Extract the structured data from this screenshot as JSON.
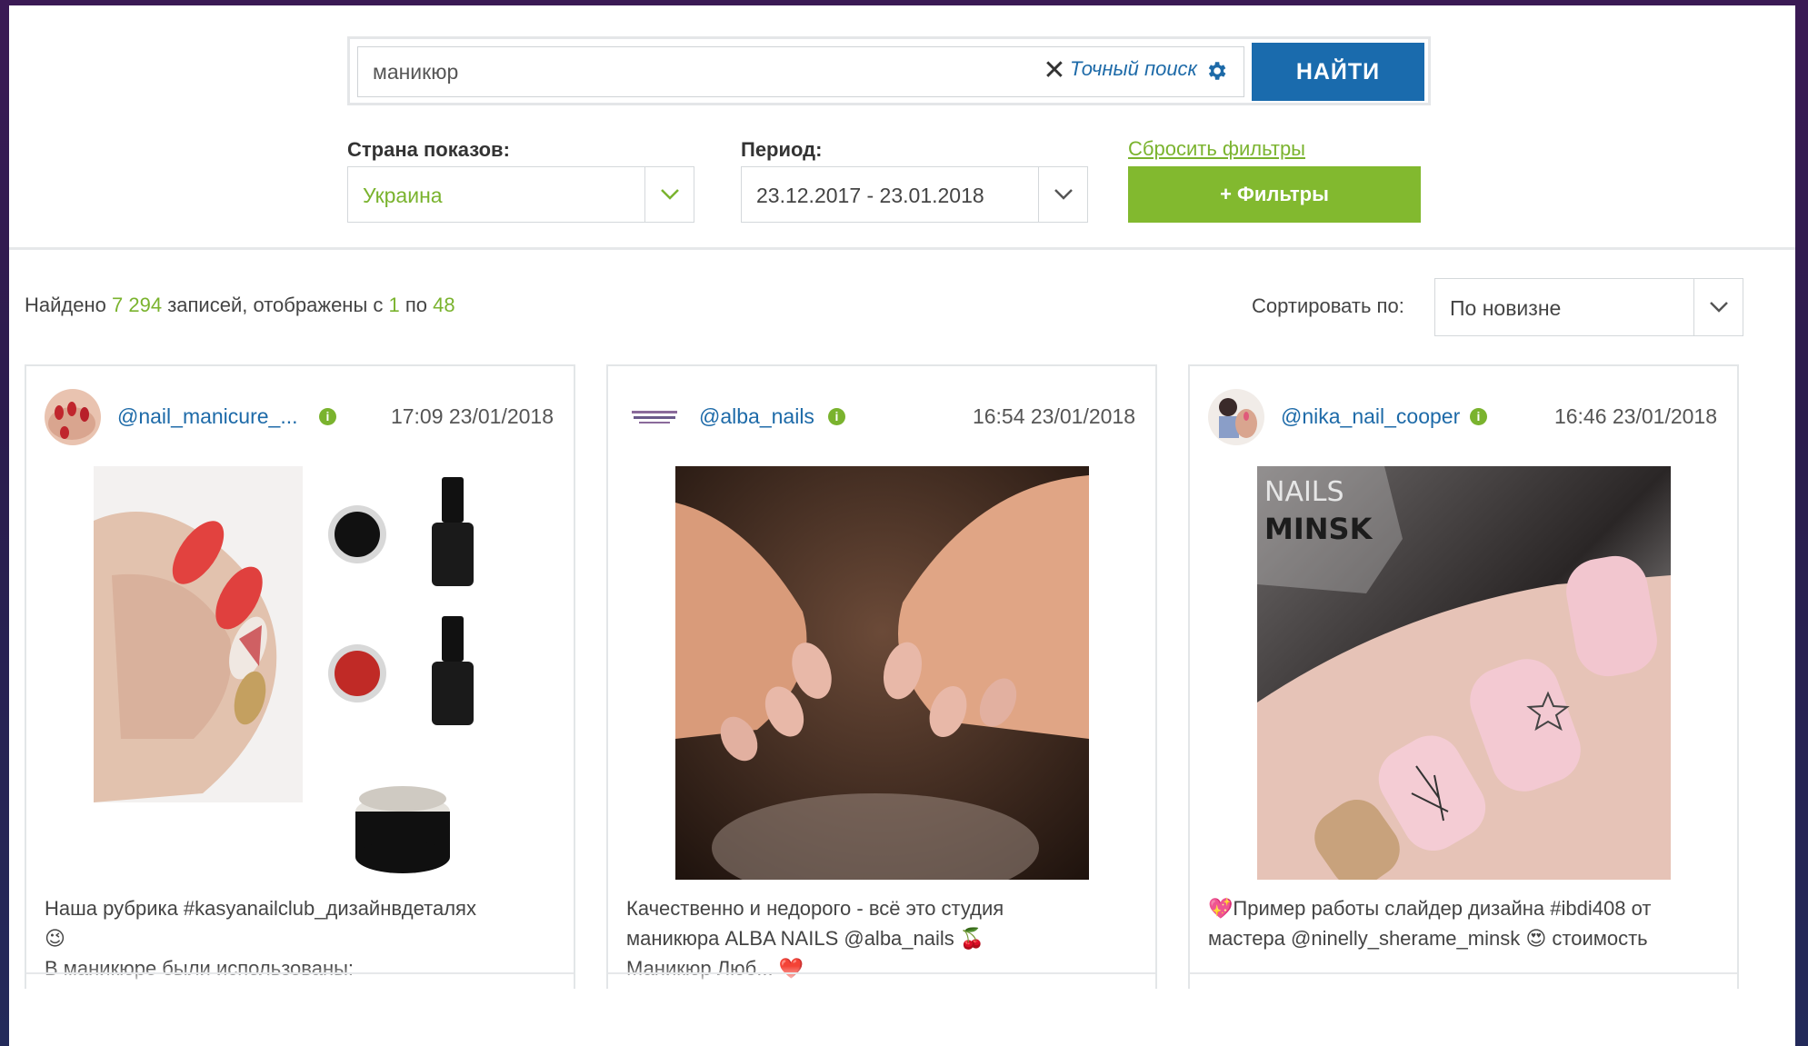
{
  "search": {
    "value": "маникюр",
    "exact_label": "Точный поиск",
    "find_label": "НАЙТИ"
  },
  "filters": {
    "country_label": "Страна показов:",
    "country_value": "Украина",
    "period_label": "Период:",
    "period_value": "23.12.2017 - 23.01.2018",
    "reset_label": "Сбросить фильтры",
    "filters_button": "+ Фильтры"
  },
  "results": {
    "found_prefix": "Найдено",
    "total": "7 294",
    "records_text": "записей, отображены с",
    "from": "1",
    "to_text": "по",
    "to": "48"
  },
  "sort": {
    "label": "Сортировать по:",
    "value": "По новизне"
  },
  "colors": {
    "accent_blue": "#1a6bad",
    "accent_green": "#82b92f"
  },
  "posts": [
    {
      "handle": "@nail_manicure_...",
      "time": "17:09 23/01/2018",
      "caption_line1": "Наша рубрика #kasyanailclub_дизайнвдеталях",
      "caption_line2": "😉",
      "caption_line3": "В маникюре были использованы:"
    },
    {
      "handle": "@alba_nails",
      "time": "16:54 23/01/2018",
      "caption_line1": "Качественно и недорого - всё это студия",
      "caption_line2": "маникюра ALBA NAILS @alba_nails 🍒",
      "caption_line3": "Маникюр Люб... ❤️"
    },
    {
      "handle": "@nika_nail_cooper",
      "time": "16:46 23/01/2018",
      "caption_line1": "💖Пример работы слайдер дизайна #ibdi408 от",
      "caption_line2": "мастера @ninelly_sherame_minsk 😍 стоимость",
      "caption_line3": "",
      "photo_text_top": "NAILS",
      "photo_text_bottom": "MINSK"
    }
  ]
}
